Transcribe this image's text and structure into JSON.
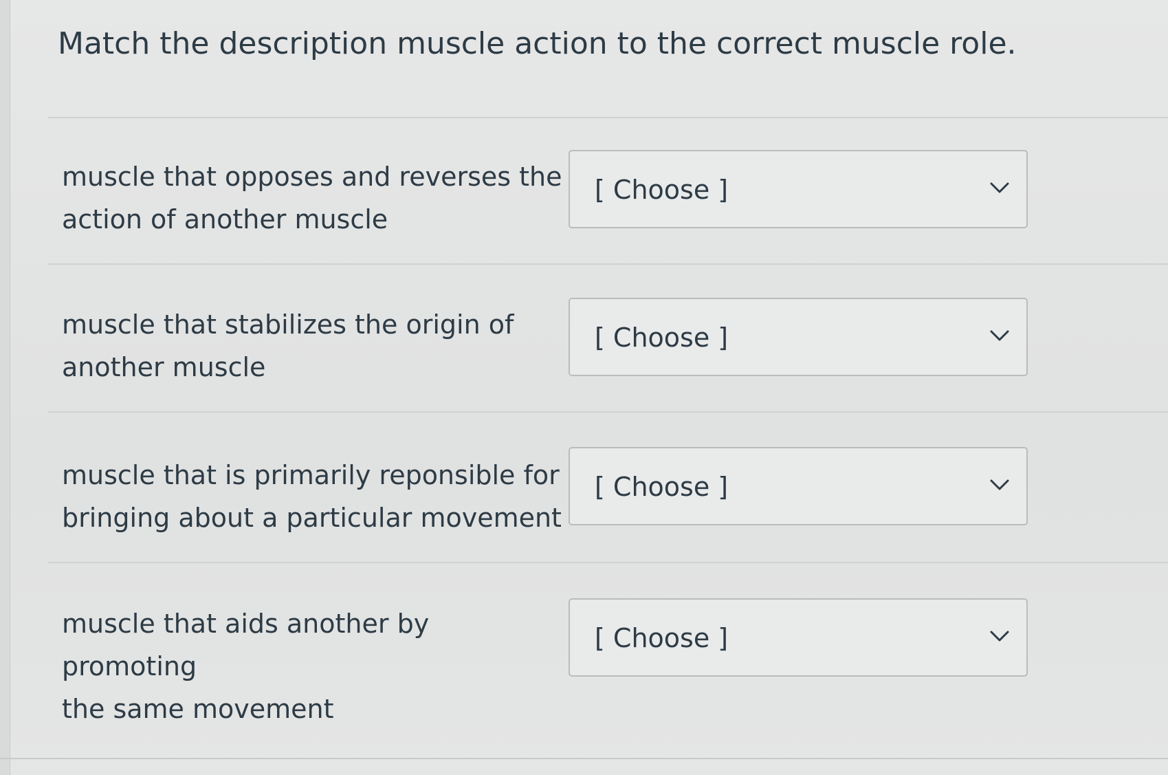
{
  "question": {
    "title": "Match the description muscle action to the correct muscle role."
  },
  "matches": [
    {
      "prompt_line1": "muscle that opposes and reverses the",
      "prompt_line2": "action of another muscle",
      "selected": "[ Choose ]",
      "icon": "chevron-down-icon"
    },
    {
      "prompt_line1": "muscle that stabilizes the origin of",
      "prompt_line2": "another muscle",
      "selected": "[ Choose ]",
      "icon": "chevron-down-icon"
    },
    {
      "prompt_line1": "muscle that is primarily reponsible for",
      "prompt_line2": "bringing about a particular movement",
      "selected": "[ Choose ]",
      "icon": "chevron-down-icon"
    },
    {
      "prompt_line1": "muscle that aids another by promoting",
      "prompt_line2": "the same movement",
      "selected": "[ Choose ]",
      "icon": "chevron-down-icon"
    }
  ],
  "colors": {
    "text": "#2d3b45",
    "background": "#e3e4e4",
    "select_border": "#b9bcbe"
  }
}
